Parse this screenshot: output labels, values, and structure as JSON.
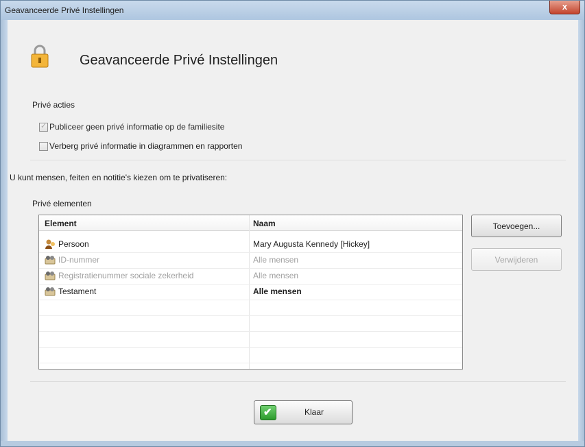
{
  "window": {
    "title": "Geavanceerde Privé Instellingen",
    "close_glyph": "x"
  },
  "header": {
    "title": "Geavanceerde Privé Instellingen",
    "icon": "lock-icon"
  },
  "private_actions": {
    "label": "Privé acties",
    "options": [
      {
        "label": "Publiceer geen privé informatie op de familiesite",
        "checked": true,
        "disabled": true
      },
      {
        "label": "Verberg privé informatie in diagrammen en rapporten",
        "checked": false,
        "disabled": false
      }
    ]
  },
  "instruction": "U kunt mensen, feiten en notitie's kiezen om te privatiseren:",
  "elements": {
    "label": "Privé elementen",
    "columns": [
      "Element",
      "Naam"
    ],
    "rows": [
      {
        "element": "Persoon",
        "name": "Mary Augusta Kennedy [Hickey]",
        "icon": "person-icon",
        "state": "normal"
      },
      {
        "element": "ID-nummer",
        "name": "Alle mensen",
        "icon": "people-fact-icon",
        "state": "disabled"
      },
      {
        "element": "Registratienummer sociale zekerheid",
        "name": "Alle mensen",
        "icon": "people-fact-icon",
        "state": "disabled"
      },
      {
        "element": "Testament",
        "name": "Alle mensen",
        "icon": "people-fact-icon",
        "state": "bold"
      }
    ]
  },
  "buttons": {
    "add": "Toevoegen...",
    "remove": "Verwijderen",
    "ok": "Klaar"
  }
}
